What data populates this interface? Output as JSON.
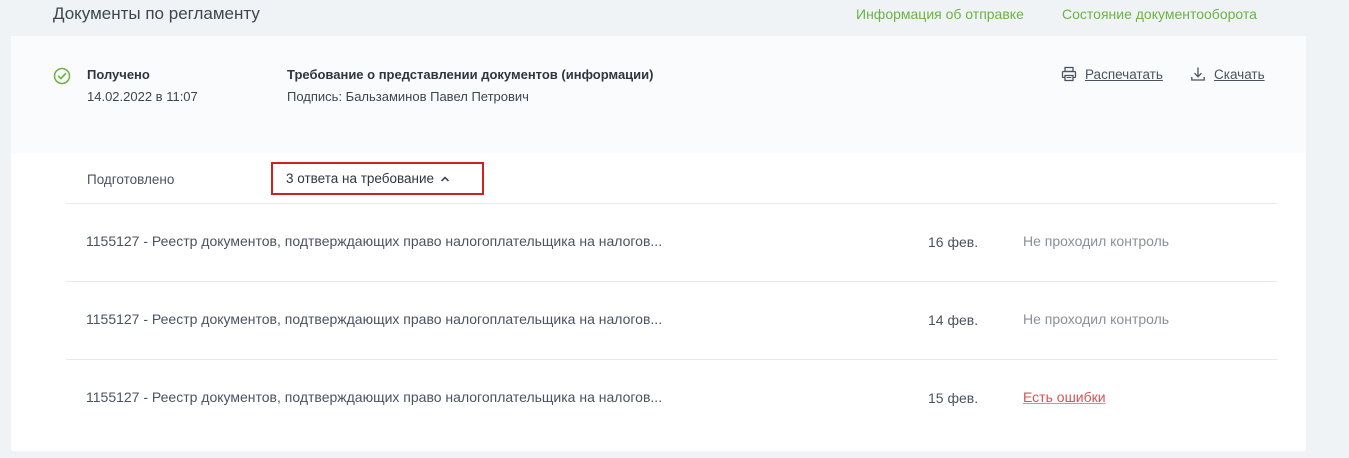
{
  "header": {
    "title": "Документы по регламенту",
    "links": {
      "info": "Информация об отправке",
      "state": "Состояние документооборота"
    }
  },
  "document": {
    "status_label": "Получено",
    "status_date": "14.02.2022 в 11:07",
    "title": "Требование о представлении документов (информации)",
    "signature": "Подпись: Бальзаминов Павел Петрович",
    "actions": {
      "print": "Распечатать",
      "download": "Скачать"
    }
  },
  "responses": {
    "prepared_label": "Подготовлено",
    "toggle_label": "3 ответа на требование",
    "items": [
      {
        "name": "1155127 - Реестр документов, подтверждающих право налогоплательщика на налогов...",
        "date": "16 фев.",
        "status": "Не проходил контроль"
      },
      {
        "name": "1155127 - Реестр документов, подтверждающих право налогоплательщика на налогов...",
        "date": "14 фев.",
        "status": "Не проходил контроль"
      },
      {
        "name": "1155127 - Реестр документов, подтверждающих право налогоплательщика на налогов...",
        "date": "15 фев.",
        "status": "Есть ошибки"
      }
    ]
  },
  "colors": {
    "accent_green": "#6cb33f",
    "error_red": "#d9534f",
    "highlight_border": "#d21f1f"
  }
}
